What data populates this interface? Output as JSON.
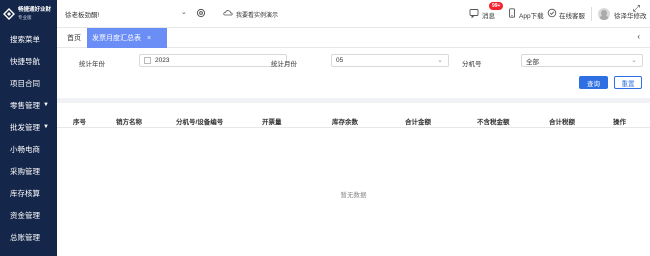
{
  "sidebar": {
    "brand_line1": "畅捷通好业财",
    "brand_line2": "专业版",
    "items": [
      {
        "label": "搜索菜单",
        "arrow": ""
      },
      {
        "label": "快捷导航",
        "arrow": ""
      },
      {
        "label": "项目合同",
        "arrow": ""
      },
      {
        "label": "零售管理",
        "arrow": "▼"
      },
      {
        "label": "批发管理",
        "arrow": "▼"
      },
      {
        "label": "小畅电商",
        "arrow": ""
      },
      {
        "label": "采购管理",
        "arrow": ""
      },
      {
        "label": "库存核算",
        "arrow": ""
      },
      {
        "label": "资金管理",
        "arrow": ""
      },
      {
        "label": "总账管理",
        "arrow": ""
      }
    ]
  },
  "topbar": {
    "company": "徐老板劲酮!",
    "caret": "⌄",
    "demo": "我要看实例演示",
    "messages": "消息",
    "messages_badge": "99+",
    "app_download": "App下载",
    "support": "在线客服",
    "user": "徐泽华修改"
  },
  "tabs": {
    "home": "首页",
    "active": "发票月度汇总表",
    "close": "×",
    "ctrl_top": "⤢",
    "ctrl": "‹"
  },
  "filters": {
    "year_label": "统计年份",
    "year_value": "2023",
    "month_label": "统计月份",
    "month_value": "05",
    "machine_label": "分机号",
    "machine_value": "全部",
    "query": "查询",
    "reset": "重置"
  },
  "table": {
    "columns": [
      "序号",
      "销方名称",
      "分机号/设备编号",
      "开票量",
      "库存余数",
      "合计金额",
      "不含税金额",
      "合计税额",
      "操作"
    ],
    "empty": "暂无数据"
  },
  "colors": {
    "sidebar": "#14264a",
    "accent": "#2f6fe4",
    "active_tab": "#6b8df6"
  }
}
